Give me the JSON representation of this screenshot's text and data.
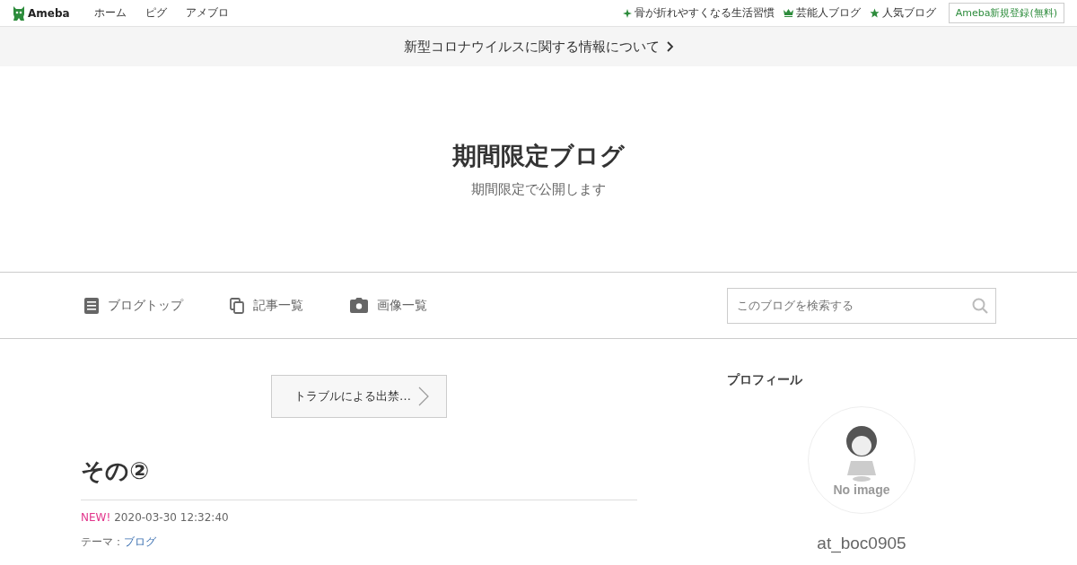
{
  "topbar": {
    "logo": "Ameba",
    "nav": [
      "ホーム",
      "ピグ",
      "アメブロ"
    ],
    "links": [
      {
        "kind": "sparkle",
        "label": "骨が折れやすくなる生活習慣"
      },
      {
        "kind": "crown",
        "label": "芸能人ブログ"
      },
      {
        "kind": "star",
        "label": "人気ブログ"
      }
    ],
    "register": "Ameba新規登録(無料)"
  },
  "notice": "新型コロナウイルスに関する情報について",
  "blog": {
    "title": "期間限定ブログ",
    "description": "期間限定で公開します"
  },
  "menu": [
    {
      "kind": "doc",
      "label": "ブログトップ"
    },
    {
      "kind": "copy",
      "label": "記事一覧"
    },
    {
      "kind": "camera",
      "label": "画像一覧"
    }
  ],
  "search": {
    "placeholder": "このブログを検索する"
  },
  "prev_entry": "トラブルによる出禁…",
  "entry": {
    "title": "その②",
    "new_badge": "NEW!",
    "datetime": "2020-03-30 12:32:40",
    "theme_label": "テーマ：",
    "theme": "ブログ"
  },
  "profile": {
    "heading": "プロフィール",
    "avatar_caption": "No image",
    "name": "at_boc0905"
  }
}
